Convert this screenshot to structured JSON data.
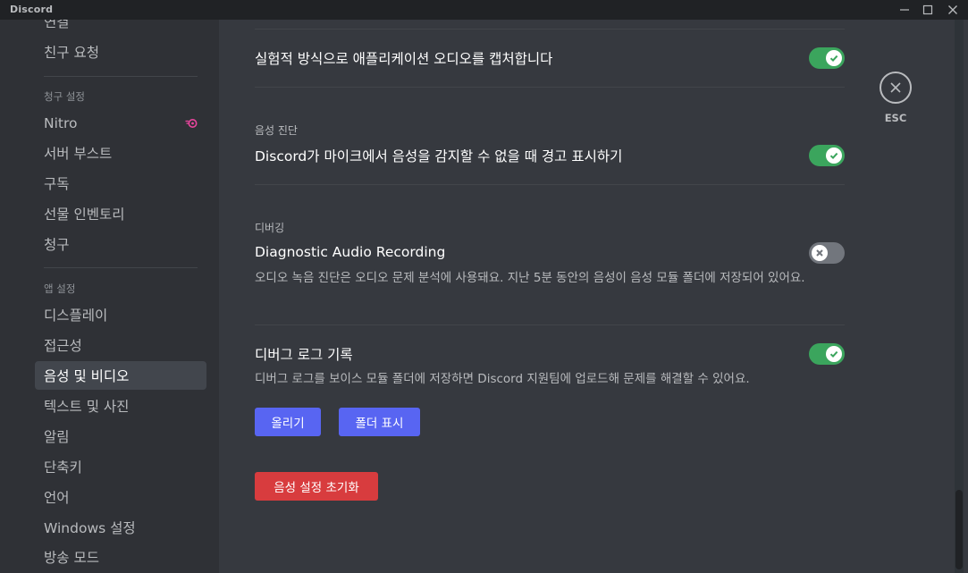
{
  "window": {
    "title": "Discord",
    "minimize_icon": "minimize-icon",
    "maximize_icon": "maximize-icon",
    "close_icon": "close-icon"
  },
  "sidebar": {
    "items_top": [
      {
        "label": "연결"
      },
      {
        "label": "친구 요청"
      }
    ],
    "billing_header": "청구 설정",
    "billing_items": [
      {
        "label": "Nitro",
        "icon": "nitro-icon"
      },
      {
        "label": "서버 부스트"
      },
      {
        "label": "구독"
      },
      {
        "label": "선물 인벤토리"
      },
      {
        "label": "청구"
      }
    ],
    "app_header": "앱 설정",
    "app_items": [
      {
        "label": "디스플레이"
      },
      {
        "label": "접근성"
      },
      {
        "label": "음성 및 비디오",
        "active": true
      },
      {
        "label": "텍스트 및 사진"
      },
      {
        "label": "알림"
      },
      {
        "label": "단축키"
      },
      {
        "label": "언어"
      },
      {
        "label": "Windows 설정"
      },
      {
        "label": "방송 모드"
      }
    ]
  },
  "main": {
    "capture_audio": {
      "title": "실험적 방식으로 애플리케이션 오디오를 캡처합니다",
      "enabled": true
    },
    "voice_diagnostics": {
      "section": "음성 진단",
      "title": "Discord가 마이크에서 음성을 감지할 수 없을 때 경고 표시하기",
      "enabled": true
    },
    "debugging": {
      "section": "디버깅",
      "title": "Diagnostic Audio Recording",
      "description": "오디오 녹음 진단은 오디오 문제 분석에 사용돼요. 지난 5분 동안의 음성이 음성 모듈 폴더에 저장되어 있어요.",
      "enabled": false
    },
    "debug_log": {
      "title": "디버그 로그 기록",
      "description": "디버그 로그를 보이스 모듈 폴더에 저장하면 Discord 지원팀에 업로드해 문제를 해결할 수 있어요.",
      "enabled": true,
      "upload_label": "올리기",
      "show_folder_label": "폴더 표시"
    },
    "reset_label": "음성 설정 초기화"
  },
  "esc": {
    "label": "ESC",
    "icon": "close-circle-icon"
  },
  "colors": {
    "accent": "#5865f2",
    "toggle_on": "#3ba55d",
    "toggle_off": "#72767d",
    "danger": "#d83c3e",
    "nitro": "#eb459e"
  }
}
